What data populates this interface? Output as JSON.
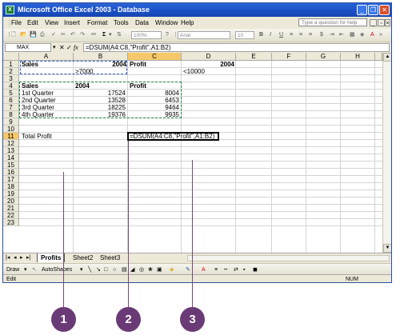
{
  "window": {
    "title": "Microsoft Office Excel 2003 - Database",
    "app_icon": "X"
  },
  "menu": {
    "items": [
      "File",
      "Edit",
      "View",
      "Insert",
      "Format",
      "Tools",
      "Data",
      "Window",
      "Help"
    ],
    "help_placeholder": "Type a question for help"
  },
  "toolbar": {
    "zoom": "100%",
    "font": "Arial",
    "size": "10"
  },
  "formula_bar": {
    "name_box": "MAX",
    "fx": "fx",
    "formula": "=DSUM(A4:C8,\"Profit\",A1:B2)"
  },
  "columns": [
    "A",
    "B",
    "C",
    "D",
    "E",
    "F",
    "G",
    "H"
  ],
  "rows": [
    "1",
    "2",
    "3",
    "4",
    "5",
    "6",
    "7",
    "8",
    "9",
    "10",
    "11",
    "12",
    "13",
    "14",
    "15",
    "16",
    "17",
    "18",
    "19",
    "20",
    "21",
    "22",
    "23"
  ],
  "cells": {
    "A1": "Sales",
    "B1": "2004",
    "C1": "Profit",
    "D1": "2004",
    "B2": ">7000",
    "D2": "<10000",
    "A4": "Sales",
    "B4": "2004",
    "C4": "Profit",
    "A5": "1st Quarter",
    "B5": "17524",
    "C5": "8004",
    "A6": "2nd Quarter",
    "B6": "13528",
    "C6": "6453",
    "A7": "3rd Quarter",
    "B7": "18225",
    "C7": "9464",
    "A8": "4th Quarter",
    "B8": "19376",
    "C8": "9935",
    "A11": "Total Profit",
    "C11": "=DSUM(A4:C8,\"Profit\",A1:B2)"
  },
  "sheets": {
    "tabs": [
      "Profits",
      "Sheet2",
      "Sheet3"
    ],
    "active": "Profits"
  },
  "drawing": {
    "draw": "Draw",
    "autoshapes": "AutoShapes"
  },
  "status": {
    "mode": "Edit",
    "num": "NUM"
  },
  "callouts": [
    "1",
    "2",
    "3"
  ]
}
